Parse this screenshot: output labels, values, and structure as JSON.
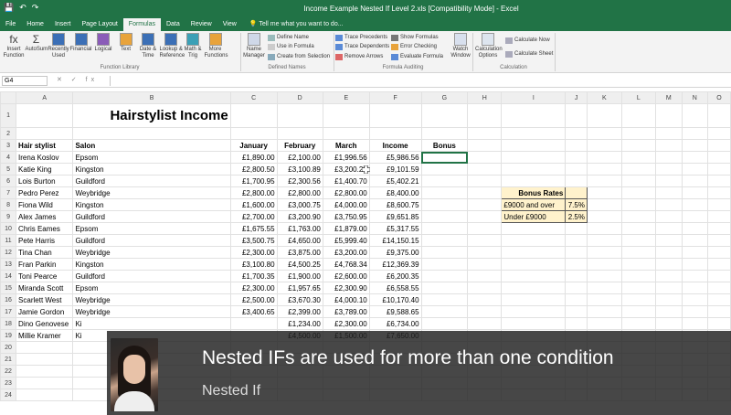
{
  "window": {
    "title": "Income Example Nested If Level 2.xls  [Compatibility Mode] - Excel",
    "colors": {
      "excel_green": "#217346",
      "bonus_fill": "#fff2cc"
    }
  },
  "tabs": [
    "File",
    "Home",
    "Insert",
    "Page Layout",
    "Formulas",
    "Data",
    "Review",
    "View"
  ],
  "tell_me": "Tell me what you want to do...",
  "ribbon": {
    "function_library": {
      "buttons": [
        {
          "label": "Insert\nFunction",
          "icon": "fx-icon"
        },
        {
          "label": "AutoSum",
          "icon": "sigma-icon"
        },
        {
          "label": "Recently\nUsed",
          "icon": "star-icon"
        },
        {
          "label": "Financial",
          "icon": "book-icon"
        },
        {
          "label": "Logical",
          "icon": "question-icon"
        },
        {
          "label": "Text",
          "icon": "text-icon"
        },
        {
          "label": "Date &\nTime",
          "icon": "clock-icon"
        },
        {
          "label": "Lookup &\nReference",
          "icon": "lookup-icon"
        },
        {
          "label": "Math &\nTrig",
          "icon": "theta-icon"
        },
        {
          "label": "More\nFunctions",
          "icon": "more-icon"
        }
      ],
      "label": "Function Library"
    },
    "defined_names": {
      "name_manager": "Name\nManager",
      "define_name": "Define Name",
      "use_in_formula": "Use in Formula",
      "create_from_selection": "Create from Selection",
      "label": "Defined Names"
    },
    "formula_auditing": {
      "trace_precedents": "Trace Precedents",
      "trace_dependents": "Trace Dependents",
      "remove_arrows": "Remove Arrows",
      "show_formulas": "Show Formulas",
      "error_checking": "Error Checking",
      "evaluate_formula": "Evaluate Formula",
      "watch_window": "Watch\nWindow",
      "label": "Formula Auditing"
    },
    "calculation": {
      "calculation_options": "Calculation\nOptions",
      "calculate_now": "Calculate Now",
      "calculate_sheet": "Calculate Sheet",
      "label": "Calculation"
    }
  },
  "formula_bar": {
    "name_box": "G4",
    "icons": "✕ ✓ fx",
    "value": ""
  },
  "columns": [
    "A",
    "B",
    "C",
    "D",
    "E",
    "F",
    "G",
    "H",
    "I",
    "J",
    "K",
    "L",
    "M",
    "N",
    "O"
  ],
  "sheet": {
    "title": "Hairstylist Income",
    "headers": [
      "Hair stylist",
      "Salon",
      "January",
      "February",
      "March",
      "Income",
      "Bonus"
    ],
    "rows": [
      [
        "Irena Koslov",
        "Epsom",
        "£1,890.00",
        "£2,100.00",
        "£1,996.56",
        "£5,986.56"
      ],
      [
        "Katie King",
        "Kingston",
        "£2,800.50",
        "£3,100.89",
        "£3,200.20",
        "£9,101.59"
      ],
      [
        "Lois Burton",
        "Guildford",
        "£1,700.95",
        "£2,300.56",
        "£1,400.70",
        "£5,402.21"
      ],
      [
        "Pedro Perez",
        "Weybridge",
        "£2,800.00",
        "£2,800.00",
        "£2,800.00",
        "£8,400.00"
      ],
      [
        "Fiona Wild",
        "Kingston",
        "£1,600.00",
        "£3,000.75",
        "£4,000.00",
        "£8,600.75"
      ],
      [
        "Alex James",
        "Guildford",
        "£2,700.00",
        "£3,200.90",
        "£3,750.95",
        "£9,651.85"
      ],
      [
        "Chris Eames",
        "Epsom",
        "£1,675.55",
        "£1,763.00",
        "£1,879.00",
        "£5,317.55"
      ],
      [
        "Pete Harris",
        "Guildford",
        "£3,500.75",
        "£4,650.00",
        "£5,999.40",
        "£14,150.15"
      ],
      [
        "Tina Chan",
        "Weybridge",
        "£2,300.00",
        "£3,875.00",
        "£3,200.00",
        "£9,375.00"
      ],
      [
        "Fran Parkin",
        "Kingston",
        "£3,100.80",
        "£4,500.25",
        "£4,768.34",
        "£12,369.39"
      ],
      [
        "Toni Pearce",
        "Guildford",
        "£1,700.35",
        "£1,900.00",
        "£2,600.00",
        "£6,200.35"
      ],
      [
        "Miranda Scott",
        "Epsom",
        "£2,300.00",
        "£1,957.65",
        "£2,300.90",
        "£6,558.55"
      ],
      [
        "Scarlett West",
        "Weybridge",
        "£2,500.00",
        "£3,670.30",
        "£4,000.10",
        "£10,170.40"
      ],
      [
        "Jamie Gordon",
        "Weybridge",
        "£3,400.65",
        "£2,399.00",
        "£3,789.00",
        "£9,588.65"
      ],
      [
        "Dino Genovese",
        "Ki",
        "",
        "£1,234.00",
        "£2,300.00",
        "£6,734.00"
      ],
      [
        "Millie Kramer",
        "Ki",
        "",
        "£4,500.00",
        "£1,500.00",
        "£7,650.00"
      ]
    ],
    "bonus_table": {
      "title": "Bonus Rates",
      "rows": [
        [
          "£9000 and over",
          "7.5%"
        ],
        [
          "Under £9000",
          "2.5%"
        ]
      ]
    },
    "row_count": 24
  },
  "video_overlay": {
    "caption": "Nested IFs are used for more than one condition",
    "subcaption": "Nested If"
  }
}
